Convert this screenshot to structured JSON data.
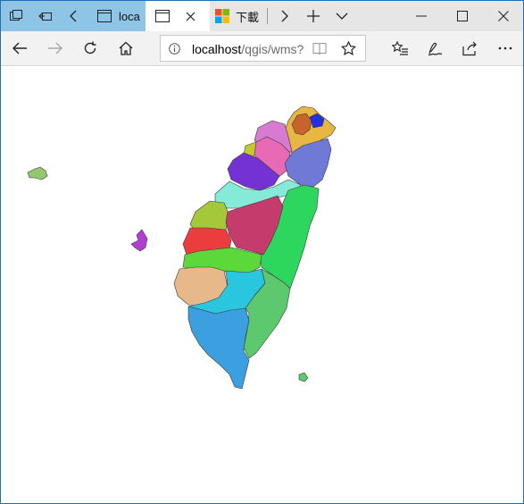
{
  "window": {
    "accent": "#1f6fb2"
  },
  "tabbar": {
    "tabs": [
      {
        "label": "loca",
        "state": "background-blue"
      },
      {
        "label": "",
        "state": "active"
      },
      {
        "label": "下載",
        "state": "background"
      }
    ]
  },
  "toolbar": {
    "url_host": "localhost",
    "url_path": "/qgis/wms?"
  },
  "map": {
    "subject": "Taiwan administrative divisions (WMS map render)",
    "colors": {
      "taipei": "#e8b741",
      "keelung": "#c8632d",
      "taipei_city": "#2230e3",
      "taoyuan": "#d77ad2",
      "hsinchu_county": "#e86ab4",
      "hsinchu_city": "#c6c832",
      "yilan": "#6e7ad6",
      "miaoli": "#7431d3",
      "taichung": "#86ead9",
      "hualien": "#2dd75e",
      "changhua": "#a5c83b",
      "nantou": "#c53c6c",
      "yunlin": "#ec3d3e",
      "chiayi": "#5bd83a",
      "tainan": "#e7b98a",
      "kaohsiung": "#2ac6e0",
      "taitung": "#5dc96e",
      "pingtung": "#3b9fe0",
      "penghu": "#b23fd2",
      "kinmen": "#93c96c"
    }
  }
}
